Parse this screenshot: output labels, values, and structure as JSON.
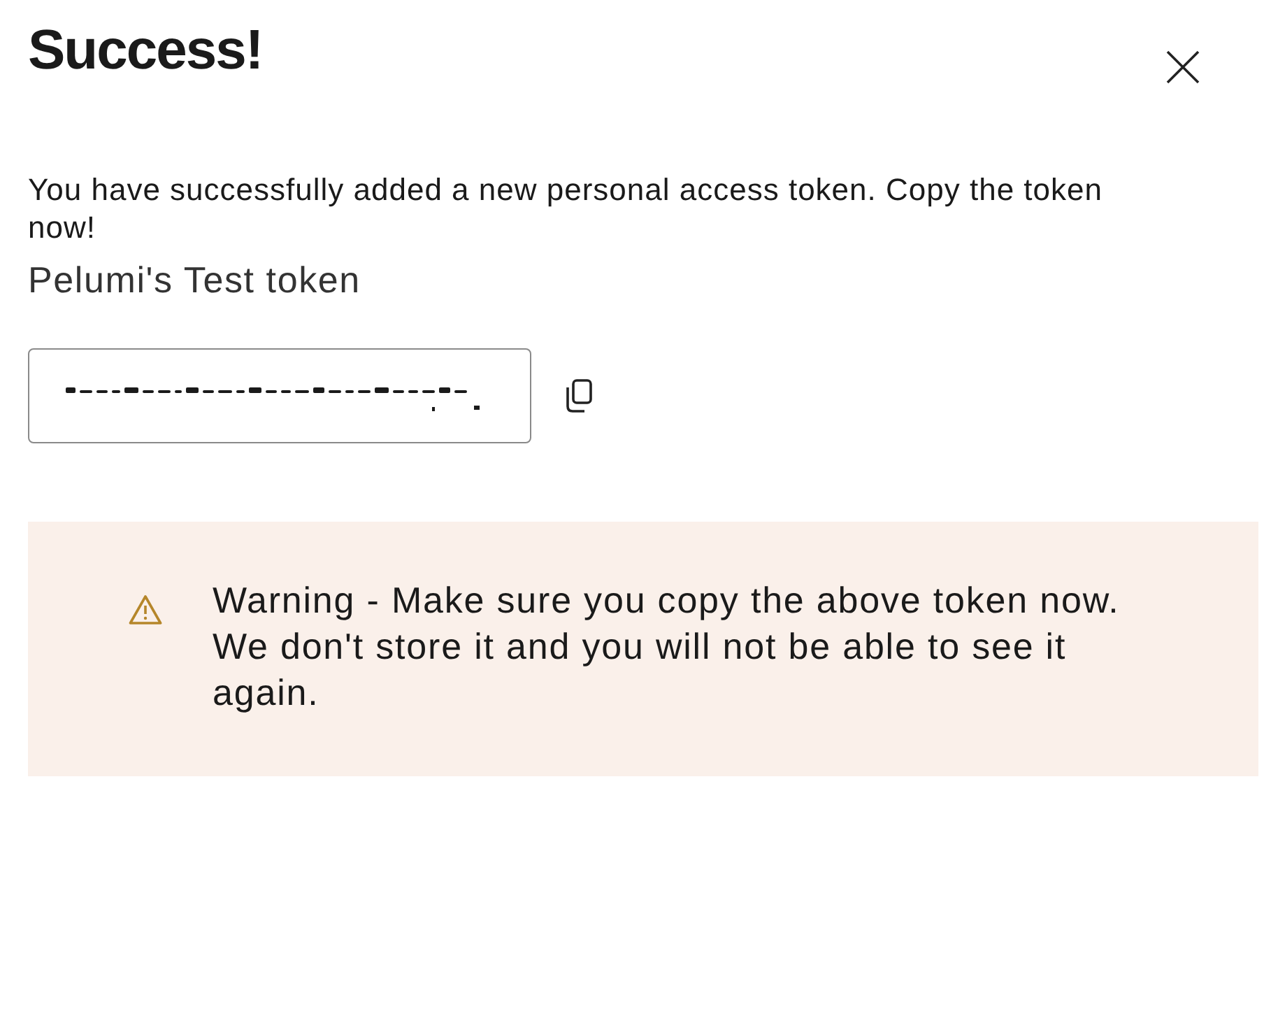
{
  "dialog": {
    "title": "Success!"
  },
  "message": "You have successfully added a new personal access token. Copy the token now!",
  "token_name": "Pelumi's Test token",
  "token_field": {
    "obscured": true
  },
  "warning": {
    "text": "Warning - Make sure you copy the above token now. We don't store it and you will not be able to see it again."
  }
}
